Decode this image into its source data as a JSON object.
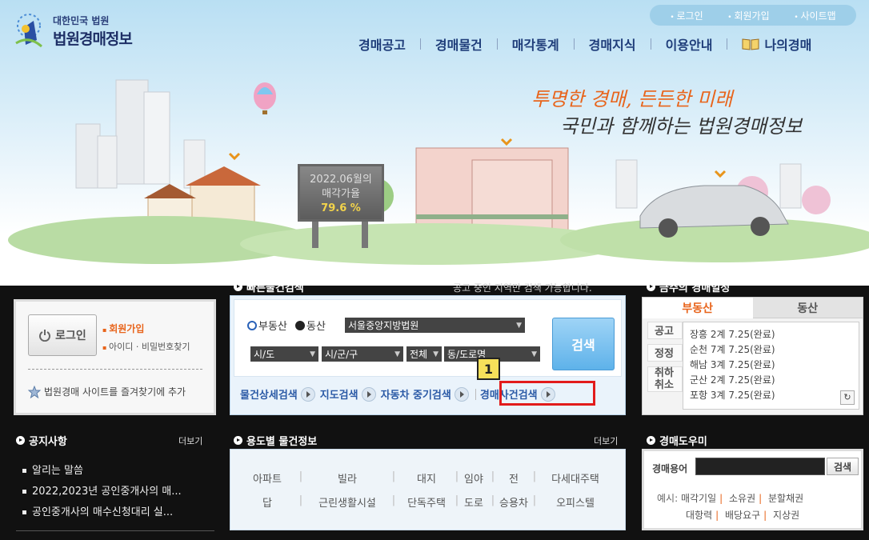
{
  "header": {
    "logo_top": "대한민국 법원",
    "logo_main": "법원경매정보",
    "util": [
      "로그인",
      "회원가입",
      "사이트맵"
    ],
    "nav": [
      "경매공고",
      "경매물건",
      "매각통계",
      "경매지식",
      "이용안내"
    ],
    "mypage": "나의경매"
  },
  "hero": {
    "slogan1": "투명한 경매, 든든한 미래",
    "slogan2": "국민과 함께하는 법원경매정보",
    "billboard_title": "2022.06월의",
    "billboard_label": "매각가율",
    "billboard_value": "79.6 %"
  },
  "login": {
    "button": "로그인",
    "join": "회원가입",
    "find": "아이디 · 비밀번호찾기",
    "favorite": "법원경매 사이트를 즐겨찾기에 추가"
  },
  "quick_search": {
    "title": "빠른물건검색",
    "note": "공고 중인 지역만 검색 가능합니다.",
    "radio_realestate": "부동산",
    "radio_movable": "동산",
    "court": "서울중앙지방법원",
    "sido": "시/도",
    "sigungu": "시/군/구",
    "all": "전체",
    "dong": "동/도로명",
    "search": "검색",
    "links": [
      "물건상세검색",
      "지도검색",
      "자동차 중기검색",
      "경매사건검색"
    ],
    "badge": "1"
  },
  "schedule": {
    "title": "금주의 경매일정",
    "tab_realestate": "부동산",
    "tab_movable": "동산",
    "cats": [
      "공고",
      "정정",
      "취하",
      "취소"
    ],
    "items": [
      "장흥 2계 7.25(완료)",
      "순천 7계 7.25(완료)",
      "해남 3계 7.25(완료)",
      "군산 2계 7.25(완료)",
      "포항 3계 7.25(완료)"
    ]
  },
  "notice": {
    "title": "공지사항",
    "more": "더보기",
    "items": [
      "알리는 말씀",
      "2022,2023년 공인중개사의 매...",
      "공인중개사의 매수신청대리 실..."
    ]
  },
  "usage": {
    "title": "용도별 물건정보",
    "more": "더보기",
    "row1": [
      "아파트",
      "빌라",
      "대지",
      "임야",
      "전",
      "다세대주택"
    ],
    "row2": [
      "답",
      "근린생활시설",
      "단독주택",
      "도로",
      "승용차",
      "오피스텔"
    ]
  },
  "glossary": {
    "title": "경매도우미",
    "label": "경매용어",
    "button": "검색",
    "example_label": "예시:",
    "ex_row1": [
      "매각기일",
      "소유권",
      "분할채권"
    ],
    "ex_row2": [
      "대항력",
      "배당요구",
      "지상권"
    ]
  },
  "colors": {
    "accent": "#e8641b",
    "nav": "#1f3d7a",
    "highlight": "#e21b1b"
  }
}
